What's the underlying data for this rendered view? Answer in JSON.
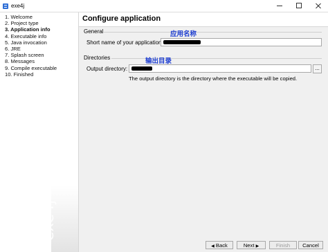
{
  "window": {
    "title": "exe4j"
  },
  "sidebar": {
    "steps": [
      "1. Welcome",
      "2. Project type",
      "3. Application info",
      "4. Executable info",
      "5. Java invocation",
      "6. JRE",
      "7. Splash screen",
      "8. Messages",
      "9. Compile executable",
      "10. Finished"
    ],
    "active_index": 2,
    "watermark": "exe4j"
  },
  "main": {
    "title": "Configure application",
    "general_section": "General",
    "short_name_label": "Short name of your application:",
    "short_name_annotation": "应用名称",
    "directories_section": "Directories",
    "output_dir_label": "Output directory:",
    "output_dir_annotation": "输出目录",
    "browse_label": "...",
    "hint": "The output directory is the directory where the executable will be copied."
  },
  "buttons": {
    "back": "Back",
    "next": "Next",
    "finish": "Finish",
    "cancel": "Cancel"
  }
}
